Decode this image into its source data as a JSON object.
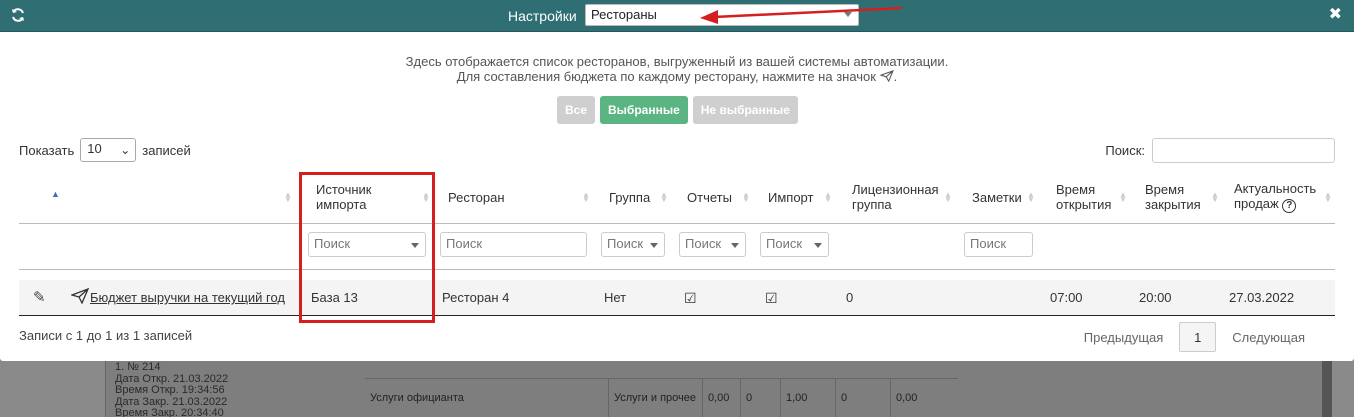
{
  "header": {
    "title": "Настройки",
    "selected_list": "Рестораны"
  },
  "intro": {
    "line1": "Здесь отображается список ресторанов, выгруженный из вашей системы автоматизации.",
    "line2": "Для составления бюджета по каждому ресторану, нажмите на значок"
  },
  "filter_buttons": [
    {
      "label": "Все",
      "active": false
    },
    {
      "label": "Выбранные",
      "active": true
    },
    {
      "label": "Не выбранные",
      "active": false
    }
  ],
  "length": {
    "prefix": "Показать",
    "value": "10",
    "suffix": "записей"
  },
  "search": {
    "label": "Поиск:",
    "value": ""
  },
  "columns": {
    "source": "Источник импорта",
    "restaurant": "Ресторан",
    "group": "Группа",
    "reports": "Отчеты",
    "import": "Импорт",
    "license": "Лицензионная группа",
    "notes": "Заметки",
    "open": "Время открытия",
    "close": "Время закрытия",
    "actual": "Актуальность продаж"
  },
  "filters": {
    "source": "Поиск",
    "restaurant": "Поиск",
    "group": "Поиск",
    "reports": "Поиск",
    "import": "Поиск",
    "notes": "Поиск"
  },
  "row": {
    "budget_link": "Бюджет выручки на текущий год",
    "source": "База 13",
    "restaurant": "Ресторан 4",
    "group": "Нет",
    "reports": "☑",
    "import": "☑",
    "license": "0",
    "open": "07:00",
    "close": "20:00",
    "actual": "27.03.2022"
  },
  "footer": {
    "info": "Записи с 1 до 1 из 1 записей",
    "prev": "Предыдущая",
    "page": "1",
    "next": "Следующая"
  },
  "background": {
    "lines": [
      "1. № 214",
      "Дата Откр. 21.03.2022",
      "Время Откр. 19:34:56",
      "Дата Закр. 21.03.2022",
      "Время Закр. 20:34:40"
    ],
    "row": [
      "Услуги официанта",
      "Услуги и прочее",
      "0,00",
      "0",
      "1,00",
      "0",
      "0,00"
    ]
  }
}
